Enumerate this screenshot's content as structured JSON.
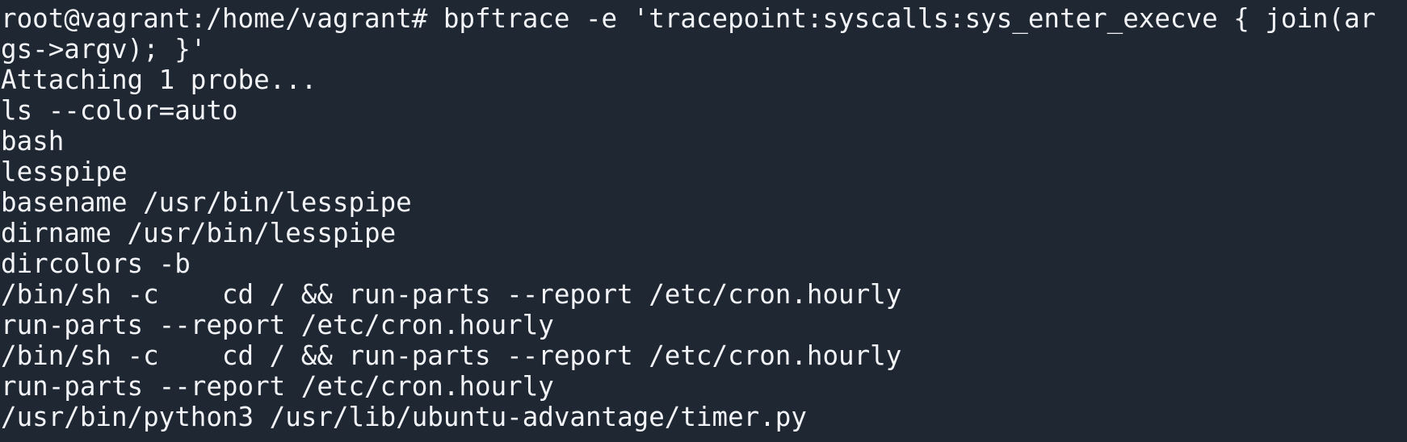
{
  "terminal": {
    "lines": [
      "root@vagrant:/home/vagrant# bpftrace -e 'tracepoint:syscalls:sys_enter_execve { join(ar",
      "gs->argv); }'",
      "Attaching 1 probe...",
      "ls --color=auto",
      "bash",
      "lesspipe",
      "basename /usr/bin/lesspipe",
      "dirname /usr/bin/lesspipe",
      "dircolors -b",
      "/bin/sh -c    cd / && run-parts --report /etc/cron.hourly",
      "run-parts --report /etc/cron.hourly",
      "/bin/sh -c    cd / && run-parts --report /etc/cron.hourly",
      "run-parts --report /etc/cron.hourly",
      "/usr/bin/python3 /usr/lib/ubuntu-advantage/timer.py"
    ]
  },
  "colors": {
    "background": "#1f2733",
    "foreground": "#f2f4f7"
  }
}
